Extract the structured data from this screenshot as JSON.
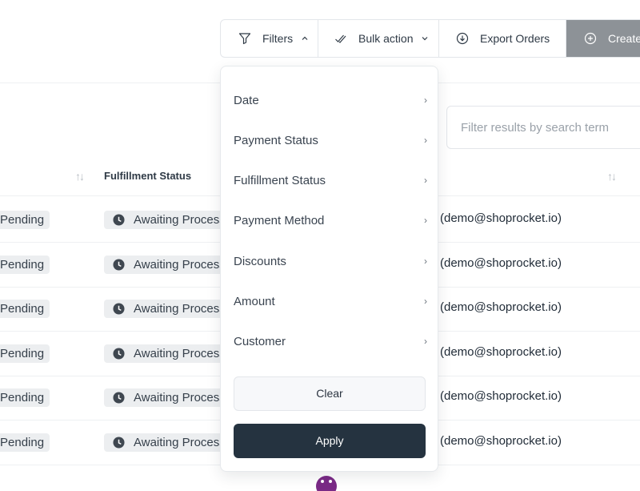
{
  "toolbar": {
    "filters_label": "Filters",
    "bulk_label": "Bulk action",
    "export_label": "Export Orders",
    "create_label": "Create"
  },
  "search": {
    "placeholder": "Filter results by search term"
  },
  "table": {
    "fulfillment_header": "Fulfillment Status",
    "rows": [
      {
        "payment": "Pending",
        "fulfillment": "Awaiting Processing",
        "email": "(demo@shoprocket.io)"
      },
      {
        "payment": "Pending",
        "fulfillment": "Awaiting Processing",
        "email": "(demo@shoprocket.io)"
      },
      {
        "payment": "Pending",
        "fulfillment": "Awaiting Processing",
        "email": "(demo@shoprocket.io)"
      },
      {
        "payment": "Pending",
        "fulfillment": "Awaiting Processing",
        "email": "(demo@shoprocket.io)"
      },
      {
        "payment": "Pending",
        "fulfillment": "Awaiting Processing",
        "email": "(demo@shoprocket.io)"
      },
      {
        "payment": "Pending",
        "fulfillment": "Awaiting Processing",
        "email": "(demo@shoprocket.io)"
      }
    ]
  },
  "filters_menu": {
    "items": [
      {
        "label": "Date"
      },
      {
        "label": "Payment Status"
      },
      {
        "label": "Fulfillment Status"
      },
      {
        "label": "Payment Method"
      },
      {
        "label": "Discounts"
      },
      {
        "label": "Amount"
      },
      {
        "label": "Customer"
      }
    ],
    "clear_label": "Clear",
    "apply_label": "Apply"
  },
  "colors": {
    "apply_bg": "#253340",
    "create_bg": "#8d9297",
    "badge_bg": "#eceef0",
    "avatar": "#7a2a86"
  }
}
